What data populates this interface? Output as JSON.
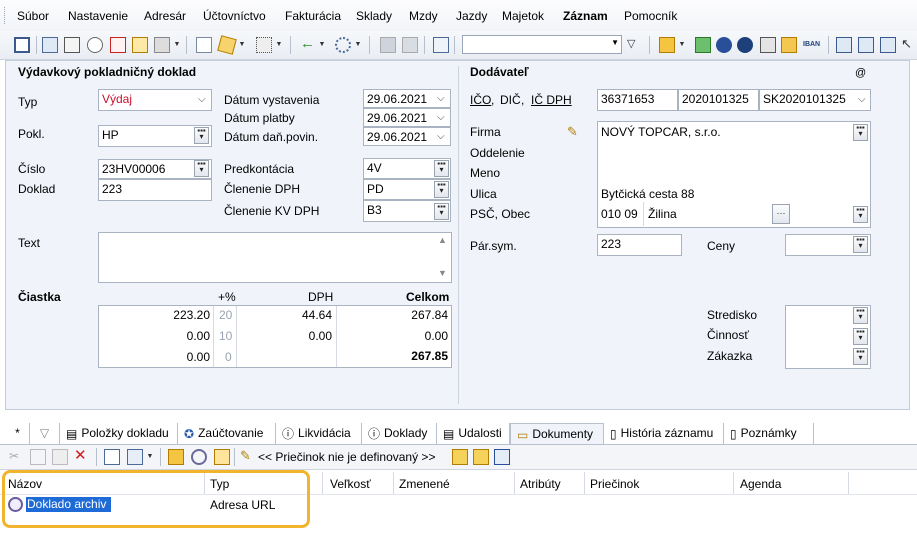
{
  "menu": [
    "Súbor",
    "Nastavenie",
    "Adresár",
    "Účtovníctvo",
    "Fakturácia",
    "Sklady",
    "Mzdy",
    "Jazdy",
    "Majetok",
    "Záznam",
    "Pomocník"
  ],
  "menu_active": "Záznam",
  "form": {
    "title": "Výdavkový pokladničný doklad",
    "typ_label": "Typ",
    "typ_value": "Výdaj",
    "pokl_label": "Pokl.",
    "pokl_value": "HP",
    "cislo_label": "Číslo",
    "cislo_value": "23HV00006",
    "doklad_label": "Doklad",
    "doklad_value": "223",
    "dvyst_label": "Dátum vystavenia",
    "dvyst_value": "29.06.2021",
    "dplat_label": "Dátum platby",
    "dplat_value": "29.06.2021",
    "ddan_label": "Dátum daň.povin.",
    "ddan_value": "29.06.2021",
    "predk_label": "Predkontácia",
    "predk_value": "4V",
    "cldph_label": "Členenie DPH",
    "cldph_value": "PD",
    "clkv_label": "Členenie KV DPH",
    "clkv_value": "B3",
    "text_label": "Text",
    "ciastka_label": "Čiastka",
    "col_pct": "+%",
    "col_dph": "DPH",
    "col_celkom": "Celkom",
    "rows": [
      {
        "base": "223.20",
        "pct": "20",
        "dph": "44.64",
        "celkom": "267.84"
      },
      {
        "base": "0.00",
        "pct": "10",
        "dph": "0.00",
        "celkom": "0.00"
      },
      {
        "base": "0.00",
        "pct": "0",
        "dph": "",
        "celkom": "267.85"
      }
    ]
  },
  "supplier": {
    "title": "Dodávateľ",
    "at": "@",
    "ico_label": "IČO",
    "dic_label": "DIČ",
    "icdph_label": "IČ DPH",
    "ico": "36371653",
    "dic": "2020101325",
    "icdph": "SK2020101325",
    "firma_label": "Firma",
    "firma": "NOVÝ TOPCAR, s.r.o.",
    "oddelenie_label": "Oddelenie",
    "meno_label": "Meno",
    "ulica_label": "Ulica",
    "ulica": "Bytčická cesta 88",
    "psc_label": "PSČ, Obec",
    "psc": "010 09",
    "obec": "Žilina",
    "parsym_label": "Pár.sym.",
    "parsym": "223",
    "ceny_label": "Ceny",
    "stredisko_label": "Stredisko",
    "cinnost_label": "Činnosť",
    "zakazka_label": "Zákazka"
  },
  "tabs": [
    "*",
    "",
    "Položky dokladu",
    "Zaúčtovanie",
    "Likvidácia",
    "Doklady",
    "Udalosti",
    "Dokumenty",
    "História záznamu",
    "Poznámky"
  ],
  "doc_toolbar": {
    "folder_msg": "<< Priečinok nie je definovaný >>"
  },
  "grid": {
    "columns": [
      "Názov",
      "Typ",
      "Veľkosť",
      "Zmenené",
      "Atribúty",
      "Priečinok",
      "Agenda"
    ],
    "rows": [
      {
        "name": "Doklado archiv",
        "type": "Adresa URL"
      }
    ]
  }
}
